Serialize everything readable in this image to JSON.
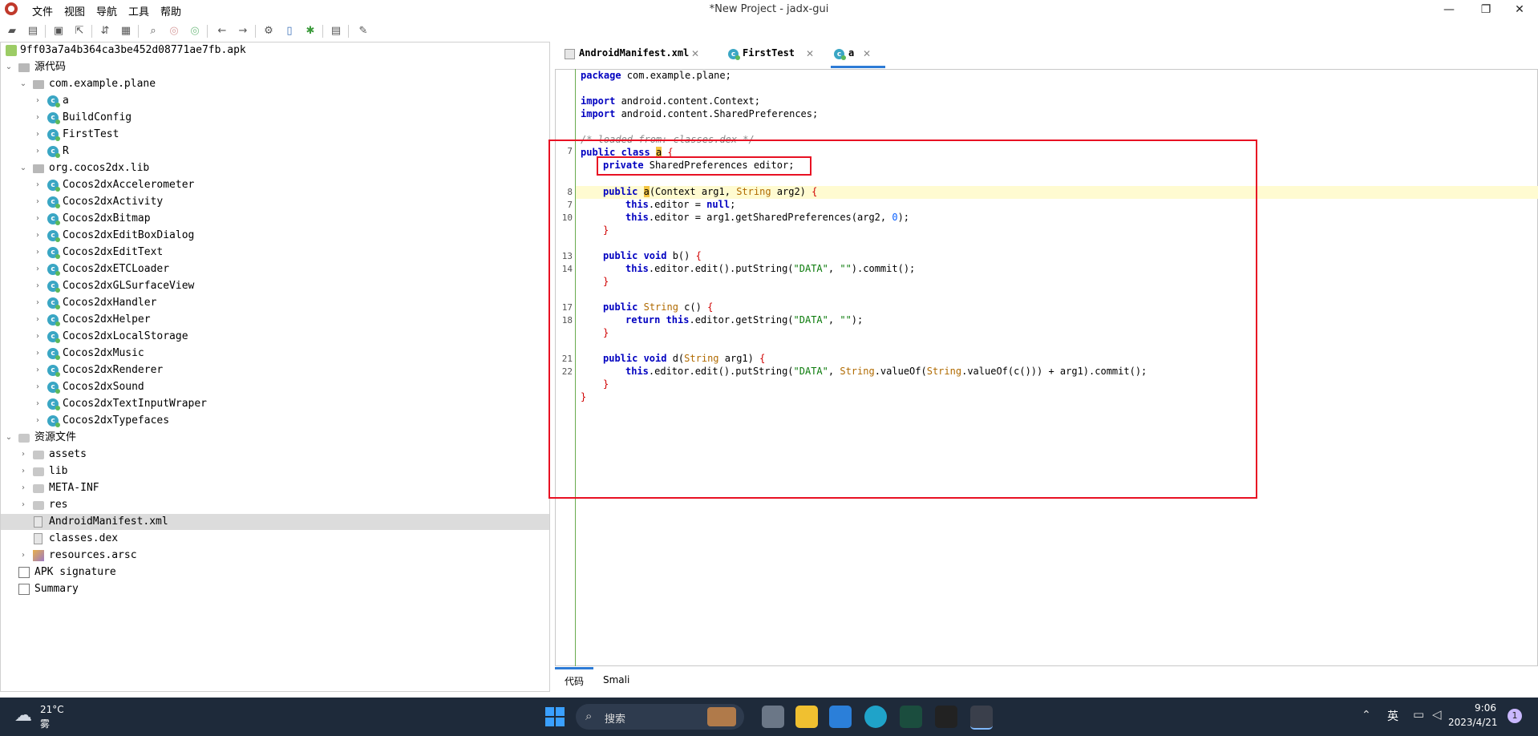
{
  "window": {
    "title": "*New Project - jadx-gui",
    "menus": [
      "文件",
      "视图",
      "导航",
      "工具",
      "帮助"
    ],
    "controls": {
      "minimize": "—",
      "restore": "❐",
      "close": "✕"
    }
  },
  "toolbar": {
    "icons": [
      "open-file-icon",
      "add-files-icon",
      "save-icon",
      "export-icon",
      "sync-tree-icon",
      "flatten-packages-icon",
      "search-icon",
      "find-class-icon",
      "find-usage-icon",
      "back-icon",
      "forward-icon",
      "decompile-all-icon",
      "bookmark-icon",
      "debug-icon",
      "log-icon",
      "preferences-icon"
    ]
  },
  "tree": {
    "apk": "9ff03a7a4b364ca3be452d08771ae7fb.apk",
    "source_root": "源代码",
    "packages": [
      {
        "name": "com.example.plane",
        "classes": [
          "a",
          "BuildConfig",
          "FirstTest",
          "R"
        ]
      },
      {
        "name": "org.cocos2dx.lib",
        "classes": [
          "Cocos2dxAccelerometer",
          "Cocos2dxActivity",
          "Cocos2dxBitmap",
          "Cocos2dxEditBoxDialog",
          "Cocos2dxEditText",
          "Cocos2dxETCLoader",
          "Cocos2dxGLSurfaceView",
          "Cocos2dxHandler",
          "Cocos2dxHelper",
          "Cocos2dxLocalStorage",
          "Cocos2dxMusic",
          "Cocos2dxRenderer",
          "Cocos2dxSound",
          "Cocos2dxTextInputWraper",
          "Cocos2dxTypefaces"
        ]
      }
    ],
    "resources_root": "资源文件",
    "resource_items": [
      "assets",
      "lib",
      "META-INF",
      "res",
      "AndroidManifest.xml",
      "classes.dex",
      "resources.arsc"
    ],
    "selected_item": "AndroidManifest.xml",
    "extra": [
      "APK signature",
      "Summary"
    ]
  },
  "tabs": [
    {
      "label": "AndroidManifest.xml",
      "icon": "MF"
    },
    {
      "label": "FirstTest",
      "icon": "C"
    },
    {
      "label": "a",
      "icon": "C",
      "active": true
    }
  ],
  "code": {
    "line_numbers": [
      "7",
      "8",
      "7",
      "10",
      "13",
      "14",
      "17",
      "18",
      "21",
      "22"
    ],
    "package_line": "package com.example.plane;",
    "import1": "import android.content.Context;",
    "import2": "import android.content.SharedPreferences;",
    "comment": "/* loaded from: classes.dex */",
    "field": "private SharedPreferences editor;",
    "strings": {
      "data": "\"DATA\"",
      "empty": "\"\""
    },
    "zero": "0"
  },
  "bottom_tabs": [
    "代码",
    "Smali"
  ],
  "taskbar": {
    "weather_temp": "21°C",
    "weather_desc": "雾",
    "search": "搜索",
    "ime": "英",
    "time": "9:06",
    "date": "2023/4/21",
    "notification_count": "1"
  }
}
